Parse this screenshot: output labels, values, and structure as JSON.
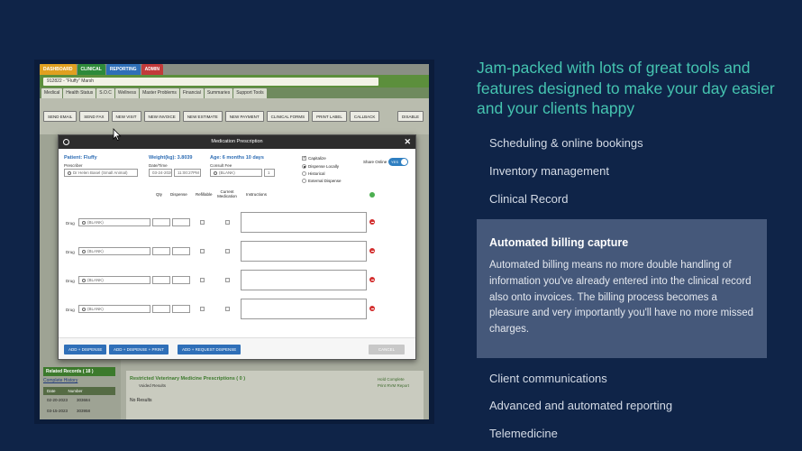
{
  "app": {
    "top_tabs": [
      "DASHBOARD",
      "CLINICAL",
      "REPORTING",
      "ADMIN"
    ],
    "patient_bar": "912822 - \"Fluffy\" Marsh",
    "sub_tabs": [
      "Medical",
      "Health Status",
      "S.O.C",
      "Wellness",
      "Master Problems",
      "Financial",
      "Summaries",
      "Support Tools"
    ],
    "toolbar": [
      "SEND EMAIL",
      "SEND FAX",
      "NEW VISIT",
      "NEW INVOICE",
      "NEW ESTIMATE",
      "NEW PAYMENT",
      "CLINICAL FORMS",
      "PRINT LABEL",
      "CALLBACK"
    ],
    "toolbar_disable": "DISABLE",
    "related_records": {
      "title": "Related Records ( 18 )",
      "history_link": "Complete History",
      "columns": [
        "Date",
        "Number"
      ],
      "rows": [
        {
          "date": "02-20-2023",
          "number": "303684"
        },
        {
          "date": "03-15-2023",
          "number": "303958"
        }
      ]
    },
    "restricted": {
      "title": "Restricted Veterinary Medicine Prescriptions ( 0 )",
      "sub": "Voided Results",
      "no_results": "No Results",
      "right_links": [
        "Hold Complete",
        "Print RVM Report"
      ]
    }
  },
  "modal": {
    "title": "Medication Prescription",
    "patient_label": "Patient: Fluffy",
    "prescriber_label": "Prescriber",
    "prescriber_value": "Dr Helen Basel (Small Animal)",
    "weight_label": "Weight(kg): 3.8039",
    "datetime_label": "Date/Time",
    "date_value": "03-24-2020",
    "time_value": "11:00:27PM",
    "age_label": "Age: 6 months 10 days",
    "consult_label": "Consult Fee",
    "consult_placeholder": "(BLANK)",
    "consult_qty": "1",
    "options": [
      {
        "label": "Capitalize",
        "kind": "check",
        "on": true
      },
      {
        "label": "Dispense Locally",
        "kind": "radio",
        "on": true
      },
      {
        "label": "Historical",
        "kind": "radio",
        "on": false
      },
      {
        "label": "External Dispense",
        "kind": "radio",
        "on": false
      }
    ],
    "share_label": "Share Online",
    "share_value": "YES",
    "columns": [
      "Qty",
      "Dispense",
      "Refillable",
      "Current Medication",
      "Instructions"
    ],
    "drug_label": "Drug",
    "drug_placeholder": "(BLANK)",
    "drug_row_count": 4,
    "buttons": {
      "add_dispense": "ADD + DISPENSE",
      "add_dispense_print": "ADD + DISPENSE + PRINT",
      "add_request": "ADD + REQUEST DISPENSE",
      "cancel": "CANCEL"
    }
  },
  "headline": "Jam-packed with lots of great tools and features designed to make your day easier and your clients happy",
  "features_top": [
    "Scheduling & online bookings",
    "Inventory management",
    "Clinical Record"
  ],
  "active_feature": {
    "title": "Automated billing capture",
    "body": "Automated billing means no more double handling of information you've already entered into the clinical record also onto invoices. The billing process becomes a pleasure and very importantly you'll have no more missed charges."
  },
  "features_bottom": [
    "Client communications",
    "Advanced and automated reporting",
    "Telemedicine"
  ],
  "colors": {
    "background": "#0f2448",
    "headline": "#45c4b0",
    "card": "#45587a",
    "text": "#d4dbe6"
  }
}
